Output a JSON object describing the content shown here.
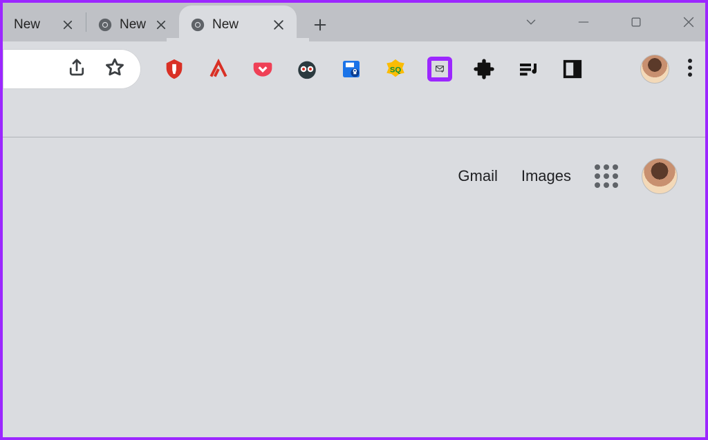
{
  "tabs": [
    {
      "title": "New",
      "active": false
    },
    {
      "title": "New",
      "active": false
    },
    {
      "title": "New",
      "active": true
    }
  ],
  "content": {
    "gmail_label": "Gmail",
    "images_label": "Images"
  },
  "highlight_extension": "mail-compose"
}
